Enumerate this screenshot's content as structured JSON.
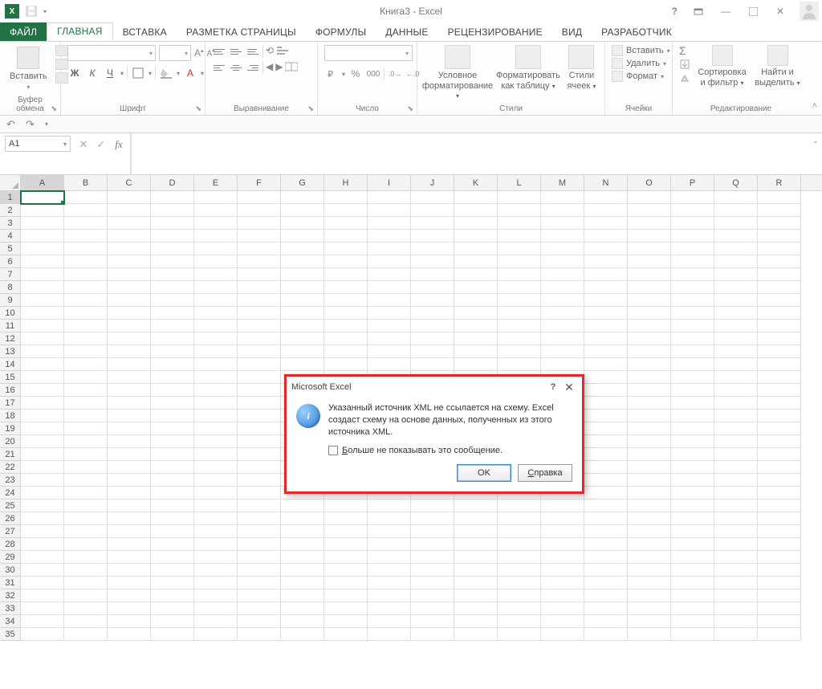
{
  "app": {
    "title": "Книга3 - Excel"
  },
  "qat": {
    "save": "save",
    "dropdown": "▾"
  },
  "window": {
    "help": "?",
    "ribbonopts": "▾",
    "min": "—",
    "max": "☐",
    "close": "✕"
  },
  "tabs": {
    "file": "ФАЙЛ",
    "home": "ГЛАВНАЯ",
    "insert": "ВСТАВКА",
    "pagelayout": "РАЗМЕТКА СТРАНИЦЫ",
    "formulas": "ФОРМУЛЫ",
    "data": "ДАННЫЕ",
    "review": "РЕЦЕНЗИРОВАНИЕ",
    "view": "ВИД",
    "developer": "РАЗРАБОТЧИК"
  },
  "ribbon": {
    "clipboard": {
      "paste": "Вставить",
      "label": "Буфер обмена"
    },
    "font": {
      "label": "Шрифт",
      "bold": "Ж",
      "italic": "К",
      "underline": "Ч",
      "grow": "A",
      "shrink": "A"
    },
    "alignment": {
      "label": "Выравнивание"
    },
    "number": {
      "label": "Число",
      "pctzeros": "000"
    },
    "styles": {
      "label": "Стили",
      "conditional": "Условное форматирование",
      "formatTable": "Форматировать как таблицу",
      "cellStyles": "Стили ячеек"
    },
    "cells": {
      "label": "Ячейки",
      "insert": "Вставить",
      "delete": "Удалить",
      "format": "Формат"
    },
    "editing": {
      "label": "Редактирование",
      "sigma": "Σ",
      "fill": "▾",
      "clear": "◆",
      "sort": "Сортировка и фильтр",
      "find": "Найти и выделить"
    }
  },
  "qat2": {
    "undo": "↶",
    "redo": "↷",
    "touch": "▢"
  },
  "formula": {
    "namebox": "A1",
    "cancel": "✕",
    "enter": "✓",
    "fx": "fx"
  },
  "columns": [
    "A",
    "B",
    "C",
    "D",
    "E",
    "F",
    "G",
    "H",
    "I",
    "J",
    "K",
    "L",
    "M",
    "N",
    "O",
    "P",
    "Q",
    "R"
  ],
  "rowCount": 35,
  "activeCell": {
    "row": 1,
    "col": 0
  },
  "dialog": {
    "title": "Microsoft Excel",
    "help": "?",
    "close": "✕",
    "iconLetter": "i",
    "message": "Указанный источник XML не ссылается на схему. Excel создаст схему на основе данных, полученных из этого источника XML.",
    "checkboxPrefix": "Б",
    "checkboxRest": "ольше не показывать это сообщение.",
    "ok": "OK",
    "helpBtnPrefix": "С",
    "helpBtnRest": "правка"
  }
}
